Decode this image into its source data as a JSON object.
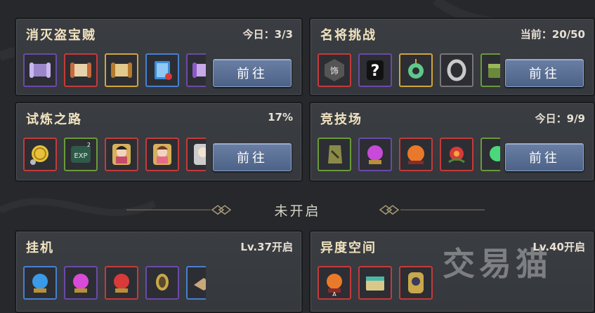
{
  "panels": [
    {
      "title": "消灭盗宝贼",
      "status": "今日：3/3",
      "button": "前往"
    },
    {
      "title": "名将挑战",
      "status": "当前：20/50",
      "button": "前往"
    },
    {
      "title": "试炼之路",
      "status": "17%",
      "button": "前往"
    },
    {
      "title": "竞技场",
      "status": "今日：9/9",
      "button": "前往"
    }
  ],
  "divider_label": "未开启",
  "locked_panels": [
    {
      "title": "挂机",
      "status": "Lv.37开启"
    },
    {
      "title": "异度空间",
      "status": "Lv.40开启"
    }
  ],
  "item_badges": {
    "exp": "EXP",
    "exp_count": "2",
    "seal": "饰",
    "mystery": "?",
    "seal_letter": "A"
  },
  "watermark": "交易猫",
  "colors": {
    "button": "#5a6f95",
    "title": "#f1e3bf",
    "panel": "#383b40"
  }
}
